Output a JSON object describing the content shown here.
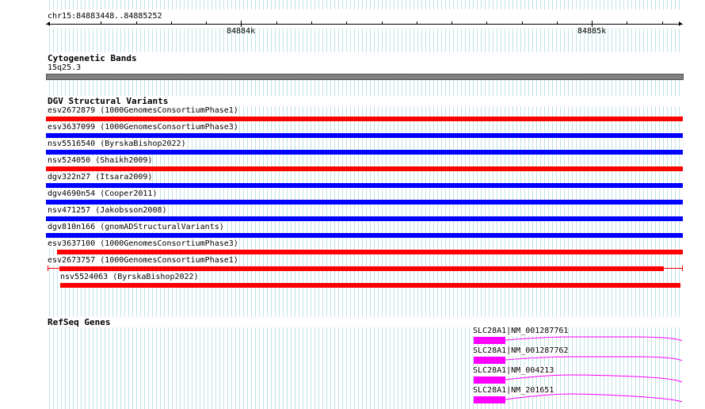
{
  "ruler": {
    "coords": "chr15:84883448..84885252",
    "tick_labels": [
      "84884k",
      "84885k"
    ]
  },
  "cyto": {
    "title": "Cytogenetic Bands",
    "band": "15q25.3"
  },
  "dgv": {
    "title": "DGV Structural Variants",
    "variants": [
      {
        "label": "esv2672879 (1000GenomesConsortiumPhase1)",
        "color": "#ff0000"
      },
      {
        "label": "esv3637099 (1000GenomesConsortiumPhase3)",
        "color": "#0000ff"
      },
      {
        "label": "nsv5516540 (ByrskaBishop2022)",
        "color": "#0000ff"
      },
      {
        "label": "nsv524050 (Shaikh2009)",
        "color": "#ff0000"
      },
      {
        "label": "dgv322n27 (Itsara2009)",
        "color": "#0000ff"
      },
      {
        "label": "dgv4690n54 (Cooper2011)",
        "color": "#0000ff"
      },
      {
        "label": "nsv471257 (Jakobsson2008)",
        "color": "#0000ff"
      },
      {
        "label": "dgv810n166 (gnomADStructuralVariants)",
        "color": "#0000ff"
      },
      {
        "label": "esv3637100 (1000GenomesConsortiumPhase3)",
        "color": "#ff0000"
      },
      {
        "label": "esv2673757 (1000GenomesConsortiumPhase1)",
        "color": "#ff0000"
      },
      {
        "label": "nsv5524063 (ByrskaBishop2022)",
        "color": "#ff0000"
      }
    ]
  },
  "refseq": {
    "title": "RefSeq Genes",
    "genes": [
      {
        "label": "SLC28A1|NM_001287761"
      },
      {
        "label": "SLC28A1|NM_001287762"
      },
      {
        "label": "SLC28A1|NM_004213"
      },
      {
        "label": "SLC28A1|NM_201651"
      }
    ]
  }
}
